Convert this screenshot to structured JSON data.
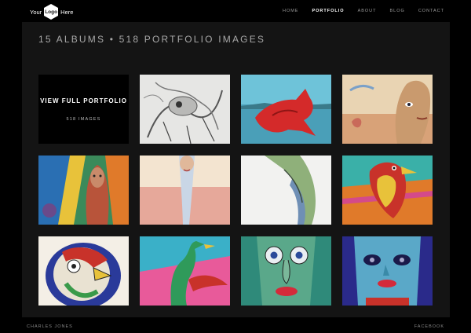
{
  "header": {
    "logo": {
      "left": "Your",
      "mark": "Logo",
      "right": "Here"
    },
    "nav": [
      {
        "label": "HOME",
        "active": false
      },
      {
        "label": "PORTFOLIO",
        "active": true
      },
      {
        "label": "ABOUT",
        "active": false
      },
      {
        "label": "BLOG",
        "active": false
      },
      {
        "label": "CONTACT",
        "active": false
      }
    ]
  },
  "main": {
    "heading": "15 ALBUMS • 518 PORTFOLIO IMAGES",
    "feature": {
      "title": "VIEW FULL PORTFOLIO",
      "count": "518 IMAGES"
    }
  },
  "footer": {
    "left": "CHARLES JONES",
    "right": "FACEBOOK"
  },
  "colors": {
    "background": "#000000",
    "panel": "#141414",
    "active_nav": "#ffffff"
  }
}
